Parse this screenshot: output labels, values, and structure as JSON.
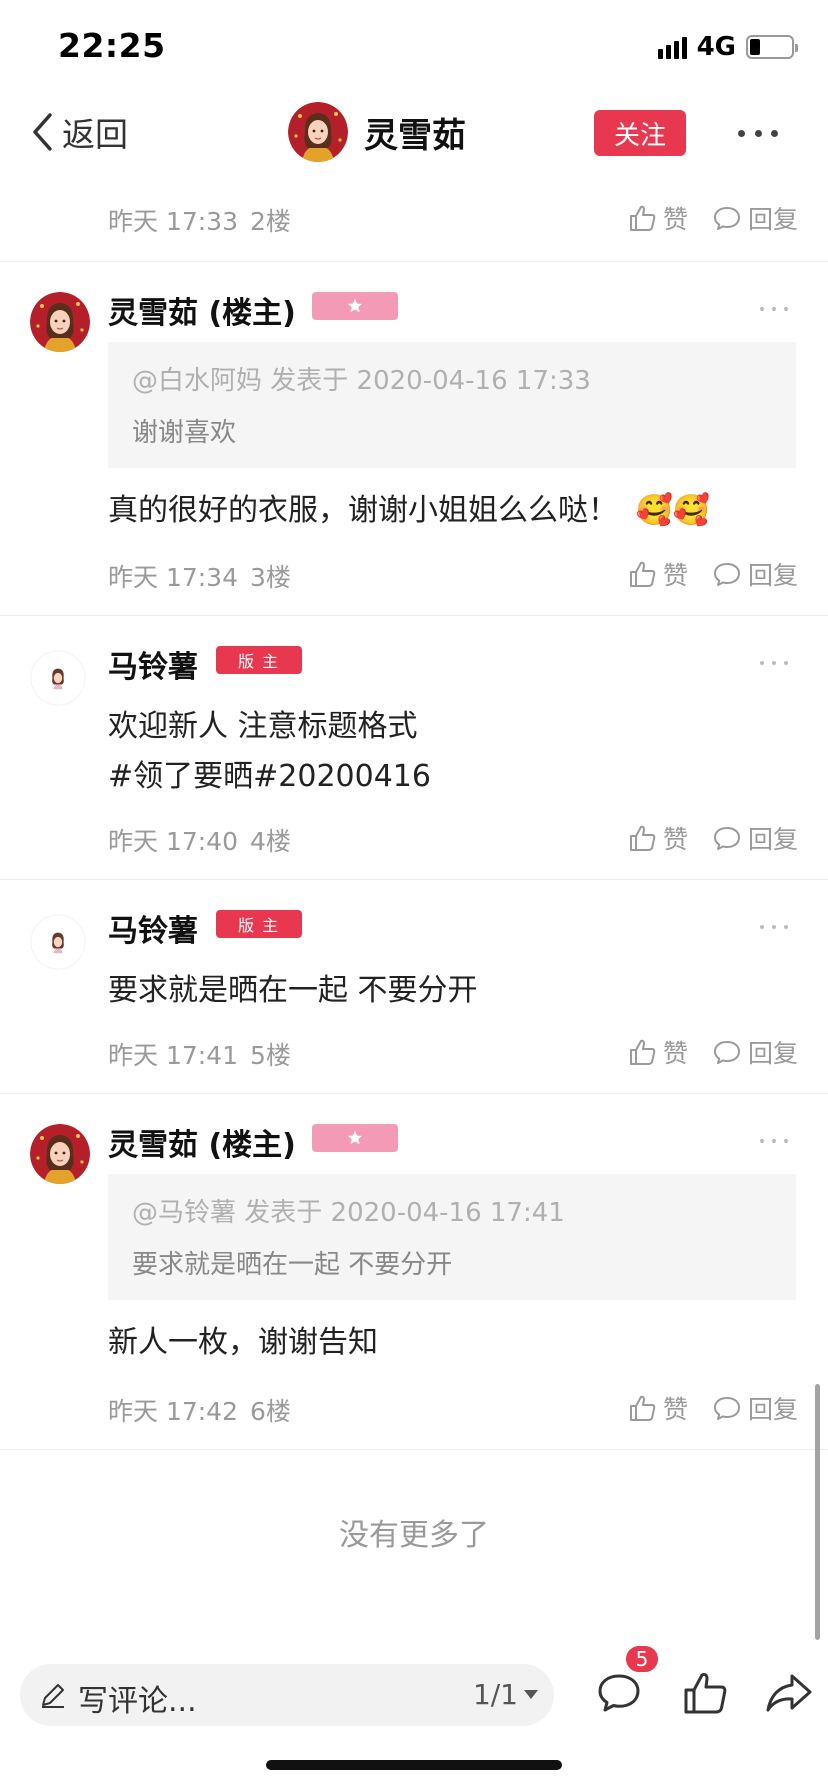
{
  "status_bar": {
    "time": "22:25",
    "network": "4G"
  },
  "nav": {
    "back_label": "返回",
    "title": "灵雪茹",
    "follow_label": "关注"
  },
  "top_row": {
    "time": "昨天 17:33",
    "floor": "2楼"
  },
  "actions": {
    "like_label": "赞",
    "reply_label": "回复"
  },
  "comments": [
    {
      "username": "灵雪茹 (楼主)",
      "badge": "star",
      "quote_meta": "@白水阿妈 发表于 2020-04-16 17:33",
      "quote_text": "谢谢喜欢",
      "body": "真的很好的衣服，谢谢小姐姐么么哒！",
      "emoji": "🥰🥰",
      "time": "昨天 17:34",
      "floor": "3楼"
    },
    {
      "username": "马铃薯",
      "badge": "版主",
      "body_line1": "欢迎新人 注意标题格式",
      "body_line2": "#领了要晒#20200416",
      "time": "昨天 17:40",
      "floor": "4楼"
    },
    {
      "username": "马铃薯",
      "badge": "版主",
      "body": "要求就是晒在一起 不要分开",
      "time": "昨天 17:41",
      "floor": "5楼"
    },
    {
      "username": "灵雪茹 (楼主)",
      "badge": "star",
      "quote_meta": "@马铃薯 发表于 2020-04-16 17:41",
      "quote_text": "要求就是晒在一起 不要分开",
      "body": "新人一枚，谢谢告知",
      "time": "昨天 17:42",
      "floor": "6楼"
    }
  ],
  "no_more_text": "没有更多了",
  "bottom_bar": {
    "placeholder": "写评论...",
    "page": "1/1",
    "comment_count": "5"
  },
  "colors": {
    "accent": "#e8384f",
    "star_badge": "#f29ab6"
  }
}
